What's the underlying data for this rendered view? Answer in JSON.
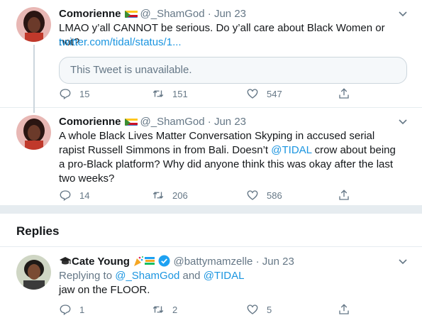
{
  "tweets": [
    {
      "display_name": "Comorienne",
      "handle": "@_ShamGod",
      "date": "Jun 23",
      "text": "LMAO y’all CANNOT be serious. Do y’all care about Black Women or not?",
      "link": "twitter.com/tidal/status/1...",
      "quote_unavailable": "This Tweet is unavailable.",
      "replies": "15",
      "retweets": "151",
      "likes": "547"
    },
    {
      "display_name": "Comorienne",
      "handle": "@_ShamGod",
      "date": "Jun 23",
      "text_before_mention": "A whole Black Lives Matter Conversation Skyping in accused serial rapist Russell Simmons in from Bali. Doesn’t ",
      "mention": "@TIDAL",
      "text_after_mention": " crow about being a pro-Black platform? Why did anyone think this was okay after the last two weeks?",
      "replies": "14",
      "retweets": "206",
      "likes": "586"
    }
  ],
  "replies_section": {
    "title": "Replies"
  },
  "reply": {
    "display_name": "Cate Young",
    "handle": "@battymamzelle",
    "date": "Jun 23",
    "replying_prefix": "Replying to ",
    "replying_user1": "@_ShamGod",
    "replying_and": " and ",
    "replying_user2": "@TIDAL",
    "text": "jaw on the FLOOR.",
    "replies": "1",
    "retweets": "2",
    "likes": "5"
  },
  "separator_dot": "·",
  "colors": {
    "accent": "#1b95e0",
    "muted": "#657786",
    "border": "#e6ecf0",
    "verified": "#1da1f2"
  },
  "icons": [
    "chevron-down-icon",
    "reply-icon",
    "retweet-icon",
    "like-icon",
    "share-icon",
    "comoros-flag-icon",
    "graduation-cap-icon",
    "party-popper-icon",
    "books-icon",
    "verified-icon"
  ]
}
